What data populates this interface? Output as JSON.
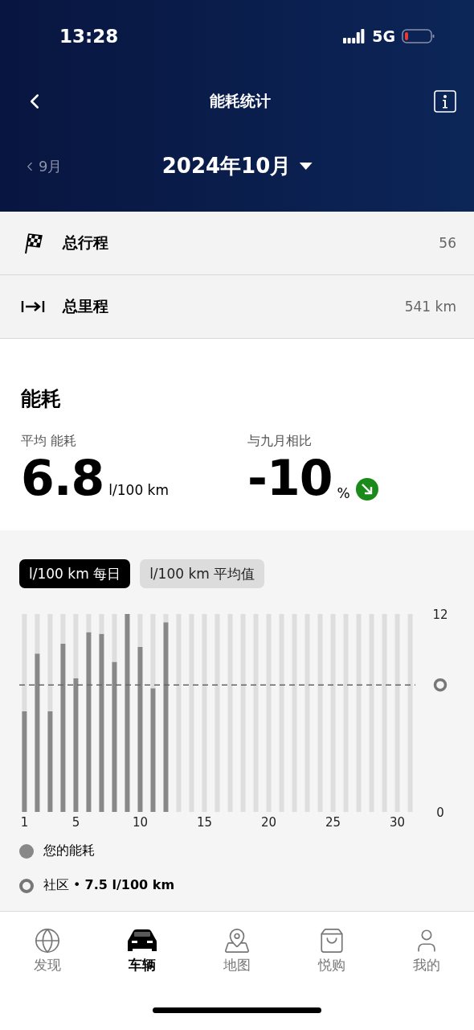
{
  "status_bar": {
    "time": "13:28",
    "network": "5G"
  },
  "header": {
    "title": "能耗统计",
    "prev_month": "9月",
    "month": "2024年10月"
  },
  "summary": [
    {
      "kind": "flag",
      "label": "总行程",
      "value": "56"
    },
    {
      "kind": "distance",
      "label": "总里程",
      "value": "541 km"
    }
  ],
  "consumption": {
    "title": "能耗",
    "average": {
      "label": "平均 能耗",
      "value": "6.8",
      "unit": "l/100 km"
    },
    "comparison": {
      "label": "与九月相比",
      "value": "-10",
      "unit": "%",
      "down": true
    }
  },
  "chart_tabs": [
    {
      "label": "l/100 km 每日",
      "selected": true
    },
    {
      "label": "l/100 km 平均值",
      "selected": false
    }
  ],
  "chart_data": {
    "type": "bar",
    "x": [
      1,
      2,
      3,
      4,
      5,
      6,
      7,
      8,
      9,
      10,
      11,
      12,
      13,
      14,
      15,
      16,
      17,
      18,
      19,
      20,
      21,
      22,
      23,
      24,
      25,
      26,
      27,
      28,
      29,
      30,
      31
    ],
    "series": [
      {
        "name": "您的能耗",
        "color": "#888888",
        "values": [
          6.1,
          9.6,
          6.1,
          10.2,
          8.1,
          10.9,
          10.8,
          9.1,
          12,
          10,
          7.5,
          11.5,
          null,
          null,
          null,
          null,
          null,
          null,
          null,
          null,
          null,
          null,
          null,
          null,
          null,
          null,
          null,
          null,
          null,
          null,
          null
        ]
      },
      {
        "color": "#dedede",
        "values": [
          5.9,
          2.4,
          5.9,
          1.8,
          3.9,
          1.1,
          1.2,
          2.9,
          0,
          2,
          4.5,
          0.5,
          12,
          12,
          12,
          12,
          12,
          12,
          12,
          12,
          12,
          12,
          12,
          12,
          12,
          12,
          12,
          12,
          12,
          12,
          12
        ]
      }
    ],
    "stacked": true,
    "ylim": [
      0,
      12
    ],
    "yticks": [
      0,
      12
    ],
    "xticks": [
      1,
      5,
      10,
      15,
      20,
      25,
      30
    ],
    "xlim": [
      0.6,
      31.4
    ],
    "ref_lines": [
      {
        "axis": "y",
        "value": 7.7
      }
    ]
  },
  "legend": [
    {
      "kind": "filled"
    },
    {
      "kind": "ring",
      "label": "社区 • **7.5 l/100 km**"
    }
  ],
  "tab_bar": [
    {
      "kind": "globe",
      "label": "发现",
      "selected": false
    },
    {
      "kind": "car",
      "label": "车辆",
      "selected": true
    },
    {
      "kind": "map",
      "label": "地图",
      "selected": false
    },
    {
      "kind": "shop",
      "label": "悦购",
      "selected": false
    },
    {
      "kind": "person",
      "label": "我的",
      "selected": false
    }
  ]
}
